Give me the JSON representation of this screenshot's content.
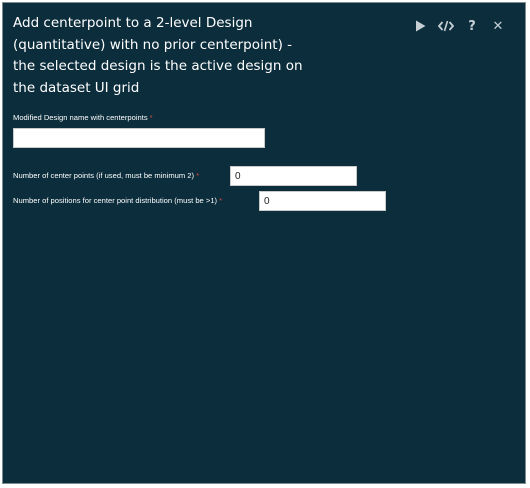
{
  "dialog": {
    "title": "Add centerpoint to a 2-level Design (quantitative) with no prior centerpoint) - the selected design is the active design on the dataset UI grid",
    "toolbar": {
      "run_icon": "play-icon",
      "code_icon": "code-icon",
      "help_label": "?",
      "close_label": "✕"
    },
    "colors": {
      "panel_background": "#0b2d3c",
      "required_marker": "#e04a3f"
    }
  },
  "form": {
    "design_name": {
      "label": "Modified Design name with centerpoints",
      "required_marker": "*",
      "value": ""
    },
    "center_points": {
      "label": "Number of center points (if used, must be minimum 2)",
      "required_marker": "*",
      "value": "0"
    },
    "positions": {
      "label": "Number of positions for center point distribution (must be >1)",
      "required_marker": "*",
      "value": "0"
    }
  }
}
